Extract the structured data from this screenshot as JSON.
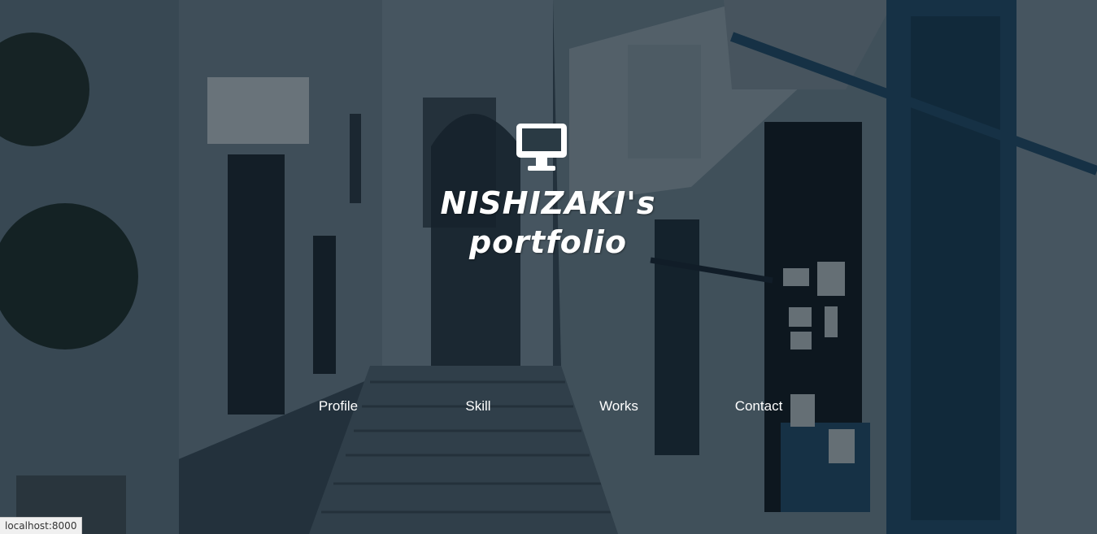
{
  "hero": {
    "title_line1": "NISHIZAKI's",
    "title_line2": "portfolio",
    "logo_icon": "desktop-monitor-icon"
  },
  "nav": {
    "items": [
      {
        "label": "Profile"
      },
      {
        "label": "Skill"
      },
      {
        "label": "Works"
      },
      {
        "label": "Contact"
      }
    ]
  },
  "status_bar": {
    "url": "localhost:8000"
  },
  "colors": {
    "overlay": "#0f1c26",
    "text": "#ffffff",
    "wall": "#6f8390",
    "door_blue": "#1f4d6b"
  }
}
